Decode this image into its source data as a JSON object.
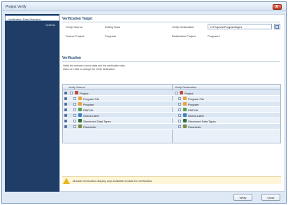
{
  "window": {
    "title": "Project Verify",
    "close_label": "x"
  },
  "sidebar": {
    "items": [
      {
        "label": "Verification Data Selection"
      },
      {
        "label": "Options"
      }
    ]
  },
  "target": {
    "section_title": "Verification Target",
    "verify_source_label": "Verify Source:",
    "verify_source_value": "Editing Data",
    "source_project_label": "Source Project:",
    "source_project_value": "Progress",
    "verify_destination_label": "Verify Destination:",
    "verify_destination_value": "C:\\Projects\\ProgramSign1",
    "destination_project_label": "Destination Project:",
    "destination_project_value": "Program1"
  },
  "verification": {
    "section_title": "Verification",
    "description_line1": "Verify the selected source data and the destination data.",
    "description_line2": "Users are able to change the verify destination."
  },
  "grid": {
    "source_header": "Verify Source",
    "destination_header": "Verify Destination",
    "rows": [
      {
        "source": "Project",
        "destination": "Project",
        "checked": true
      },
      {
        "source": "Program File",
        "destination": "Program File",
        "checked": true
      },
      {
        "source": "Program",
        "destination": "Program",
        "checked": true
      },
      {
        "source": "FB/FUN",
        "destination": "FB/FUN",
        "checked": true
      },
      {
        "source": "Global Label",
        "destination": "Global Label",
        "checked": true
      },
      {
        "source": "Structured Data Types",
        "destination": "Structured Data Types",
        "checked": true
      },
      {
        "source": "Parameter",
        "destination": "Parameter",
        "checked": true
      }
    ]
  },
  "info": {
    "message": "Module information display only available module for verification."
  },
  "footer": {
    "verify_label": "Verify",
    "close_label": "Close"
  }
}
